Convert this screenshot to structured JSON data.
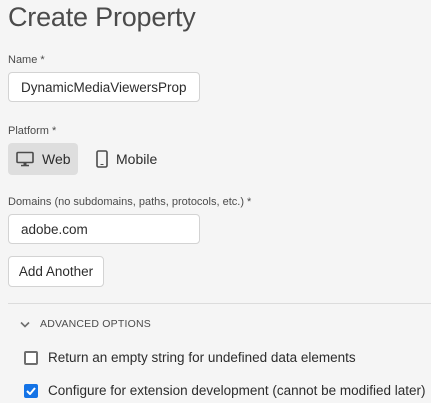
{
  "page": {
    "title": "Create Property"
  },
  "name_field": {
    "label": "Name *",
    "value": "DynamicMediaViewersProp"
  },
  "platform": {
    "label": "Platform *",
    "options": [
      {
        "label": "Web",
        "icon": "monitor-icon",
        "selected": true
      },
      {
        "label": "Mobile",
        "icon": "mobile-phone-icon",
        "selected": false
      }
    ]
  },
  "domains_field": {
    "label": "Domains (no subdomains, paths, protocols, etc.) *",
    "value": "adobe.com",
    "add_button": "Add Another"
  },
  "advanced_options": {
    "label": "ADVANCED OPTIONS",
    "expanded": true,
    "checkboxes": [
      {
        "label": "Return an empty string for undefined data elements",
        "checked": false
      },
      {
        "label": "Configure for extension development (cannot be modified later)",
        "checked": true
      }
    ]
  },
  "colors": {
    "accent": "#1473e6",
    "background": "#f5f5f5",
    "selected_toggle_bg": "#dedede"
  }
}
